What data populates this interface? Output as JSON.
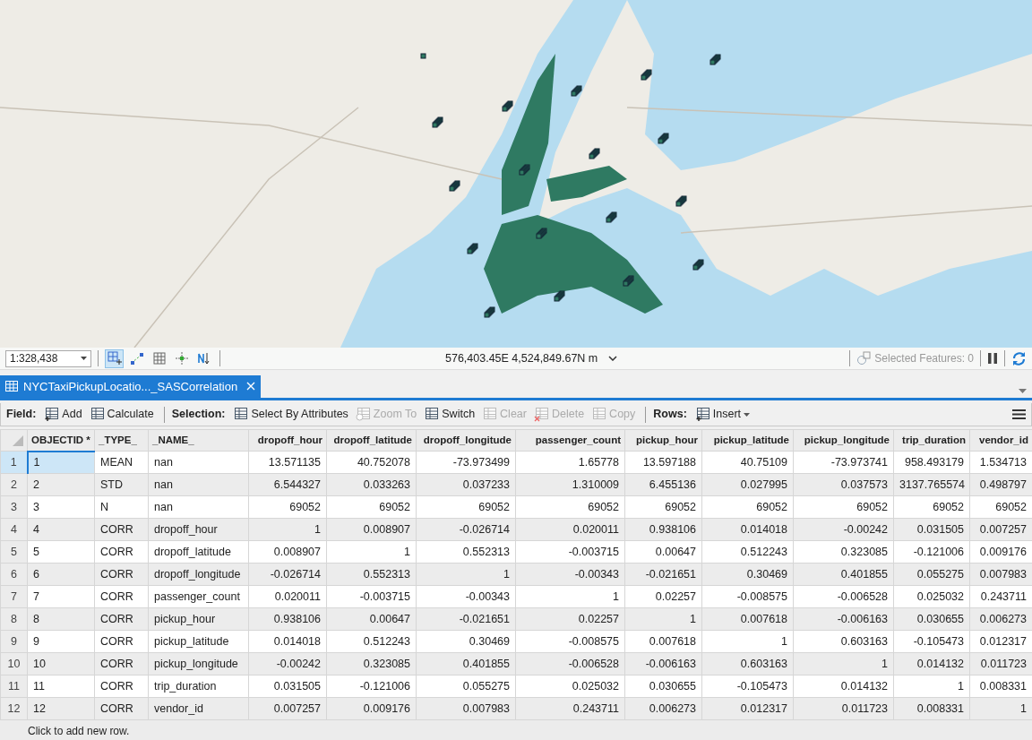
{
  "map": {
    "kind": "street-map"
  },
  "status_bar": {
    "scale": "1:328,438",
    "tools": [
      {
        "kind": "grid-plus",
        "selected": true
      },
      {
        "kind": "snap",
        "selected": false
      },
      {
        "kind": "grid",
        "selected": false
      },
      {
        "kind": "cross",
        "selected": false
      },
      {
        "kind": "north",
        "selected": false
      }
    ],
    "coordinates": "576,403.45E 4,524,849.67N m",
    "selected_features": "Selected Features: 0"
  },
  "tabs": [
    {
      "label": "NYCTaxiPickupLocatio..._SASCorrelation",
      "selected": true
    }
  ],
  "toolbar": [
    {
      "label": "Field:",
      "buttons": [
        {
          "label": "Add",
          "kind": "add",
          "disabled": false,
          "dropdown": false
        },
        {
          "label": "Calculate",
          "kind": "calculate",
          "disabled": false,
          "dropdown": false
        }
      ]
    },
    {
      "label": "Selection:",
      "buttons": [
        {
          "label": "Select By Attributes",
          "kind": "select",
          "disabled": false,
          "dropdown": false
        },
        {
          "label": "Zoom To",
          "kind": "zoom",
          "disabled": true,
          "dropdown": false
        },
        {
          "label": "Switch",
          "kind": "switch",
          "disabled": false,
          "dropdown": false
        },
        {
          "label": "Clear",
          "kind": "clear",
          "disabled": true,
          "dropdown": false
        },
        {
          "label": "Delete",
          "kind": "delete",
          "disabled": true,
          "dropdown": false
        },
        {
          "label": "Copy",
          "kind": "copy",
          "disabled": true,
          "dropdown": false
        }
      ]
    },
    {
      "label": "Rows:",
      "buttons": [
        {
          "label": "Insert",
          "kind": "insert",
          "disabled": false,
          "dropdown": true
        }
      ]
    }
  ],
  "table": {
    "columns": [
      {
        "label": "OBJECTID *",
        "numeric": false,
        "selected": true
      },
      {
        "label": "_TYPE_",
        "numeric": false,
        "selected": false
      },
      {
        "label": "_NAME_",
        "numeric": false,
        "selected": false
      },
      {
        "label": "dropoff_hour",
        "numeric": true,
        "selected": false
      },
      {
        "label": "dropoff_latitude",
        "numeric": true,
        "selected": false
      },
      {
        "label": "dropoff_longitude",
        "numeric": true,
        "selected": false
      },
      {
        "label": "passenger_count",
        "numeric": true,
        "selected": false
      },
      {
        "label": "pickup_hour",
        "numeric": true,
        "selected": false
      },
      {
        "label": "pickup_latitude",
        "numeric": true,
        "selected": false
      },
      {
        "label": "pickup_longitude",
        "numeric": true,
        "selected": false
      },
      {
        "label": "trip_duration",
        "numeric": true,
        "selected": false
      },
      {
        "label": "vendor_id",
        "numeric": true,
        "selected": false
      }
    ],
    "rows": [
      {
        "number": "1",
        "selected": true,
        "cells": [
          "1",
          "MEAN",
          "nan",
          "13.571135",
          "40.752078",
          "-73.973499",
          "1.65778",
          "13.597188",
          "40.75109",
          "-73.973741",
          "958.493179",
          "1.534713"
        ]
      },
      {
        "number": "2",
        "selected": false,
        "cells": [
          "2",
          "STD",
          "nan",
          "6.544327",
          "0.033263",
          "0.037233",
          "1.310009",
          "6.455136",
          "0.027995",
          "0.037573",
          "3137.765574",
          "0.498797"
        ]
      },
      {
        "number": "3",
        "selected": false,
        "cells": [
          "3",
          "N",
          "nan",
          "69052",
          "69052",
          "69052",
          "69052",
          "69052",
          "69052",
          "69052",
          "69052",
          "69052"
        ]
      },
      {
        "number": "4",
        "selected": false,
        "cells": [
          "4",
          "CORR",
          "dropoff_hour",
          "1",
          "0.008907",
          "-0.026714",
          "0.020011",
          "0.938106",
          "0.014018",
          "-0.00242",
          "0.031505",
          "0.007257"
        ]
      },
      {
        "number": "5",
        "selected": false,
        "cells": [
          "5",
          "CORR",
          "dropoff_latitude",
          "0.008907",
          "1",
          "0.552313",
          "-0.003715",
          "0.00647",
          "0.512243",
          "0.323085",
          "-0.121006",
          "0.009176"
        ]
      },
      {
        "number": "6",
        "selected": false,
        "cells": [
          "6",
          "CORR",
          "dropoff_longitude",
          "-0.026714",
          "0.552313",
          "1",
          "-0.00343",
          "-0.021651",
          "0.30469",
          "0.401855",
          "0.055275",
          "0.007983"
        ]
      },
      {
        "number": "7",
        "selected": false,
        "cells": [
          "7",
          "CORR",
          "passenger_count",
          "0.020011",
          "-0.003715",
          "-0.00343",
          "1",
          "0.02257",
          "-0.008575",
          "-0.006528",
          "0.025032",
          "0.243711"
        ]
      },
      {
        "number": "8",
        "selected": false,
        "cells": [
          "8",
          "CORR",
          "pickup_hour",
          "0.938106",
          "0.00647",
          "-0.021651",
          "0.02257",
          "1",
          "0.007618",
          "-0.006163",
          "0.030655",
          "0.006273"
        ]
      },
      {
        "number": "9",
        "selected": false,
        "cells": [
          "9",
          "CORR",
          "pickup_latitude",
          "0.014018",
          "0.512243",
          "0.30469",
          "-0.008575",
          "0.007618",
          "1",
          "0.603163",
          "-0.105473",
          "0.012317"
        ]
      },
      {
        "number": "10",
        "selected": false,
        "cells": [
          "10",
          "CORR",
          "pickup_longitude",
          "-0.00242",
          "0.323085",
          "0.401855",
          "-0.006528",
          "-0.006163",
          "0.603163",
          "1",
          "0.014132",
          "0.011723"
        ]
      },
      {
        "number": "11",
        "selected": false,
        "cells": [
          "11",
          "CORR",
          "trip_duration",
          "0.031505",
          "-0.121006",
          "0.055275",
          "0.025032",
          "0.030655",
          "-0.105473",
          "0.014132",
          "1",
          "0.008331"
        ]
      },
      {
        "number": "12",
        "selected": false,
        "cells": [
          "12",
          "CORR",
          "vendor_id",
          "0.007257",
          "0.009176",
          "0.007983",
          "0.243711",
          "0.006273",
          "0.012317",
          "0.011723",
          "0.008331",
          "1"
        ]
      }
    ],
    "new_row_hint": "Click to add new row."
  }
}
